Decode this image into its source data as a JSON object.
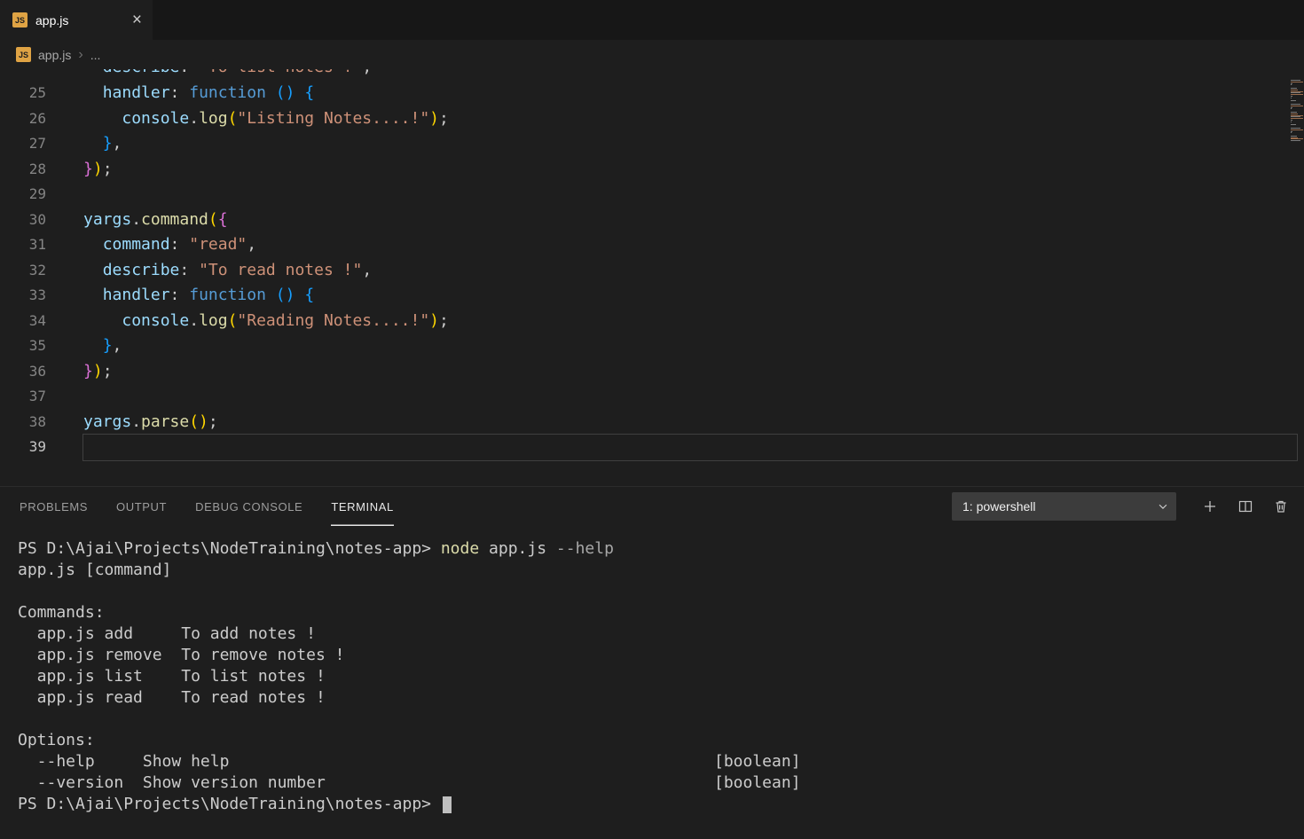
{
  "window": {
    "tab": {
      "label": "app.js",
      "close_glyph": "×"
    },
    "js_badge": "JS"
  },
  "breadcrumb": {
    "file": "app.js",
    "separator": "›",
    "more": "..."
  },
  "editor": {
    "partial_line": {
      "tokens": [
        {
          "s": "punct",
          "t": "  "
        },
        {
          "s": "ident",
          "t": "describe"
        },
        {
          "s": "punct",
          "t": ": "
        },
        {
          "s": "str",
          "t": "\"To list notes !\""
        },
        {
          "s": "punct",
          "t": ","
        }
      ]
    },
    "lines": [
      {
        "num": 25,
        "tokens": [
          {
            "s": "punct",
            "t": "  "
          },
          {
            "s": "ident",
            "t": "handler"
          },
          {
            "s": "punct",
            "t": ": "
          },
          {
            "s": "kw",
            "t": "function"
          },
          {
            "s": "punct",
            "t": " "
          },
          {
            "s": "b3",
            "t": "()"
          },
          {
            "s": "punct",
            "t": " "
          },
          {
            "s": "b3",
            "t": "{"
          }
        ]
      },
      {
        "num": 26,
        "tokens": [
          {
            "s": "punct",
            "t": "    "
          },
          {
            "s": "ident",
            "t": "console"
          },
          {
            "s": "punct",
            "t": "."
          },
          {
            "s": "fn",
            "t": "log"
          },
          {
            "s": "b1",
            "t": "("
          },
          {
            "s": "str",
            "t": "\"Listing Notes....!\""
          },
          {
            "s": "b1",
            "t": ")"
          },
          {
            "s": "punct",
            "t": ";"
          }
        ]
      },
      {
        "num": 27,
        "tokens": [
          {
            "s": "punct",
            "t": "  "
          },
          {
            "s": "b3",
            "t": "}"
          },
          {
            "s": "punct",
            "t": ","
          }
        ]
      },
      {
        "num": 28,
        "tokens": [
          {
            "s": "b2",
            "t": "}"
          },
          {
            "s": "b1",
            "t": ")"
          },
          {
            "s": "punct",
            "t": ";"
          }
        ]
      },
      {
        "num": 29,
        "tokens": []
      },
      {
        "num": 30,
        "tokens": [
          {
            "s": "ident",
            "t": "yargs"
          },
          {
            "s": "punct",
            "t": "."
          },
          {
            "s": "fn",
            "t": "command"
          },
          {
            "s": "b1",
            "t": "("
          },
          {
            "s": "b2",
            "t": "{"
          }
        ]
      },
      {
        "num": 31,
        "tokens": [
          {
            "s": "punct",
            "t": "  "
          },
          {
            "s": "ident",
            "t": "command"
          },
          {
            "s": "punct",
            "t": ": "
          },
          {
            "s": "str",
            "t": "\"read\""
          },
          {
            "s": "punct",
            "t": ","
          }
        ]
      },
      {
        "num": 32,
        "tokens": [
          {
            "s": "punct",
            "t": "  "
          },
          {
            "s": "ident",
            "t": "describe"
          },
          {
            "s": "punct",
            "t": ": "
          },
          {
            "s": "str",
            "t": "\"To read notes !\""
          },
          {
            "s": "punct",
            "t": ","
          }
        ]
      },
      {
        "num": 33,
        "tokens": [
          {
            "s": "punct",
            "t": "  "
          },
          {
            "s": "ident",
            "t": "handler"
          },
          {
            "s": "punct",
            "t": ": "
          },
          {
            "s": "kw",
            "t": "function"
          },
          {
            "s": "punct",
            "t": " "
          },
          {
            "s": "b3",
            "t": "()"
          },
          {
            "s": "punct",
            "t": " "
          },
          {
            "s": "b3",
            "t": "{"
          }
        ]
      },
      {
        "num": 34,
        "tokens": [
          {
            "s": "punct",
            "t": "    "
          },
          {
            "s": "ident",
            "t": "console"
          },
          {
            "s": "punct",
            "t": "."
          },
          {
            "s": "fn",
            "t": "log"
          },
          {
            "s": "b1",
            "t": "("
          },
          {
            "s": "str",
            "t": "\"Reading Notes....!\""
          },
          {
            "s": "b1",
            "t": ")"
          },
          {
            "s": "punct",
            "t": ";"
          }
        ]
      },
      {
        "num": 35,
        "tokens": [
          {
            "s": "punct",
            "t": "  "
          },
          {
            "s": "b3",
            "t": "}"
          },
          {
            "s": "punct",
            "t": ","
          }
        ]
      },
      {
        "num": 36,
        "tokens": [
          {
            "s": "b2",
            "t": "}"
          },
          {
            "s": "b1",
            "t": ")"
          },
          {
            "s": "punct",
            "t": ";"
          }
        ]
      },
      {
        "num": 37,
        "tokens": []
      },
      {
        "num": 38,
        "tokens": [
          {
            "s": "ident",
            "t": "yargs"
          },
          {
            "s": "punct",
            "t": "."
          },
          {
            "s": "fn",
            "t": "parse"
          },
          {
            "s": "b1",
            "t": "()"
          },
          {
            "s": "punct",
            "t": ";"
          }
        ]
      },
      {
        "num": 39,
        "tokens": [],
        "current": true
      }
    ]
  },
  "panel": {
    "tabs": [
      {
        "label": "PROBLEMS",
        "active": false
      },
      {
        "label": "OUTPUT",
        "active": false
      },
      {
        "label": "DEBUG CONSOLE",
        "active": false
      },
      {
        "label": "TERMINAL",
        "active": true
      }
    ],
    "terminal_picker": "1: powershell"
  },
  "terminal": {
    "lines": [
      {
        "tokens": [
          {
            "s": "plain",
            "t": "PS D:\\Ajai\\Projects\\NodeTraining\\notes-app> "
          },
          {
            "s": "cmd",
            "t": "node"
          },
          {
            "s": "plain",
            "t": " app.js "
          },
          {
            "s": "param",
            "t": "--help"
          }
        ]
      },
      {
        "tokens": [
          {
            "s": "plain",
            "t": "app.js [command]"
          }
        ]
      },
      {
        "tokens": []
      },
      {
        "tokens": [
          {
            "s": "plain",
            "t": "Commands:"
          }
        ]
      },
      {
        "tokens": [
          {
            "s": "plain",
            "t": "  app.js add     To add notes !"
          }
        ]
      },
      {
        "tokens": [
          {
            "s": "plain",
            "t": "  app.js remove  To remove notes !"
          }
        ]
      },
      {
        "tokens": [
          {
            "s": "plain",
            "t": "  app.js list    To list notes !"
          }
        ]
      },
      {
        "tokens": [
          {
            "s": "plain",
            "t": "  app.js read    To read notes !"
          }
        ]
      },
      {
        "tokens": []
      },
      {
        "tokens": [
          {
            "s": "plain",
            "t": "Options:"
          }
        ]
      },
      {
        "tokens": [
          {
            "s": "plain",
            "t": "  --help     Show help"
          }
        ],
        "right": "[boolean]"
      },
      {
        "tokens": [
          {
            "s": "plain",
            "t": "  --version  Show version number"
          }
        ],
        "right": "[boolean]"
      },
      {
        "tokens": [
          {
            "s": "plain",
            "t": "PS D:\\Ajai\\Projects\\NodeTraining\\notes-app> "
          }
        ],
        "cursor": true
      }
    ]
  },
  "colors": {
    "editor_bg": "#1e1e1e",
    "tabstrip_bg": "#171717",
    "select_bg": "#3c3c3c",
    "current_line_border": "#3f3f3f",
    "tokens": {
      "kw": "#569cd6",
      "ident": "#9cdcfe",
      "fn": "#dcdcaa",
      "str": "#ce9178",
      "punct": "#cccccc",
      "b1": "#ffd700",
      "b2": "#da70d6",
      "b3": "#179fff",
      "ws": "#cccccc"
    },
    "terminal": {
      "plain": "#cccccc",
      "cmd": "#dcdcaa",
      "param": "#a8a8a8"
    }
  }
}
